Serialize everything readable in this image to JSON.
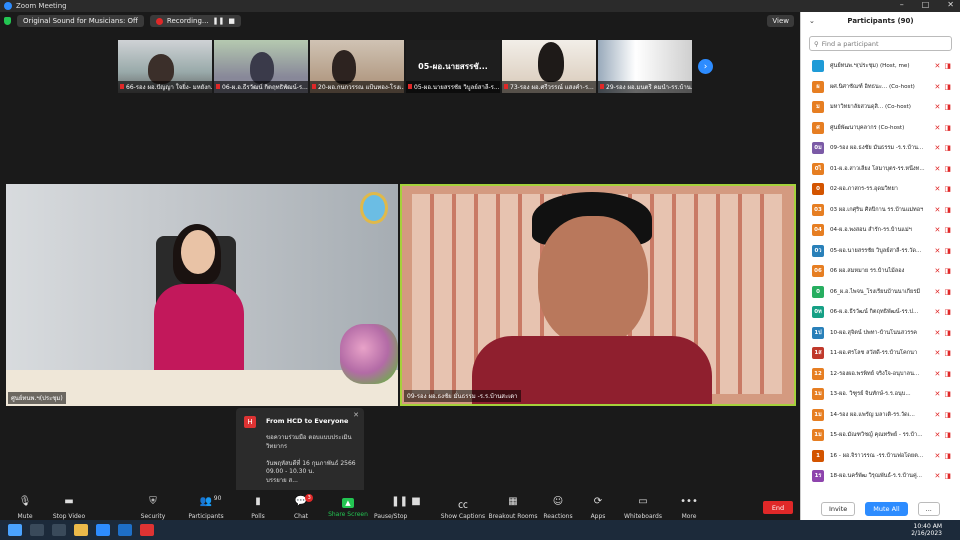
{
  "window": {
    "title": "Zoom Meeting"
  },
  "topbar": {
    "sound": "Original Sound for Musicians: Off",
    "recording": "Recording...",
    "view": "View"
  },
  "strip": [
    "66-รอง ผอ.ปัญญา ใจยิ่ง- มหยังก...",
    "06-ผ.อ.ธีรวัฒน์ กิตฤทธิพัฒน์-ร...",
    "20-ผอ.กนกวรรณ แป้นทอง-โรงเ...",
    "05-ผอ.นายสรรชัย วิบูลย์สาลี-ร...",
    "73-รอง ผอ.ศรีวรรณ์ แสงคำ-ร...",
    "29-รอง ผอ.มนตรี คมนำ-รร.บ้าน..."
  ],
  "strip_big_name": "05-ผอ.นายสรรชั...",
  "main": {
    "left_label": "ศูนย์ทนพ.ฯ(ประชุม)",
    "right_label": "09-รอง ผอ.ธงชัย มั่นธรรม -ร.ร.บ้านสะเดา"
  },
  "chat": {
    "avatar": "H",
    "header": "From HCD to Everyone",
    "body": "ขอความร่วมมือ ตอบแบบประเมิน\nวิทยากร\n\nวันพฤหัสบดีที่ 16 กุมภาพันธ์ 2566\n09.00 - 10.30 น.\nบรรยาย ส..."
  },
  "toolbar": {
    "mute": "Mute",
    "stop_video": "Stop Video",
    "security": "Security",
    "participants": "Participants",
    "participants_count": "90",
    "polls": "Polls",
    "chat": "Chat",
    "chat_badge": "3",
    "share": "Share Screen",
    "pause": "Pause/Stop Recording",
    "captions": "Show Captions",
    "breakout": "Breakout Rooms",
    "reactions": "Reactions",
    "apps": "Apps",
    "whiteboards": "Whiteboards",
    "more": "More",
    "end": "End"
  },
  "panel": {
    "title": "Participants (90)",
    "search_placeholder": "Find a participant",
    "invite": "Invite",
    "mute_all": "Mute All",
    "more": "..."
  },
  "participants": [
    {
      "av": "",
      "name": "ศูนย์ทนพ.ฯ(ประชุม)",
      "role": "(Host, me)",
      "color": "#1f9bd7"
    },
    {
      "av": "ผ",
      "name": "ผศ.นิศาชัณฑ์ อิทธนะ...",
      "role": "(Co-host)",
      "color": "#e67e22"
    },
    {
      "av": "ม",
      "name": "มหาวิทยาลัยสวนดุสิ...",
      "role": "(Co-host)",
      "color": "#e67e22"
    },
    {
      "av": "ศ",
      "name": "ศูนย์พัฒนาบุคลากร",
      "role": "(Co-host)",
      "color": "#e67e22"
    },
    {
      "av": "0ม",
      "name": "09-รอง ผอ.ธงชัย มั่นธรรม -ร.ร.บ้าน...",
      "role": "",
      "color": "#7b5aa6"
    },
    {
      "av": "0ไ",
      "name": "01-ผ.อ.สาวเลียง โสมาบุตร-รร.หนึ่งท...",
      "role": "",
      "color": "#e67e22"
    },
    {
      "av": "0",
      "name": "02-ผอ.ภาสกร-รร.อุดมวิทยา",
      "role": "",
      "color": "#d35400"
    },
    {
      "av": "03",
      "name": "03 ผอ.เกศุริน ศิลปิกาน รร.บ้านแม่ทอฯ",
      "role": "",
      "color": "#e67e22"
    },
    {
      "av": "04",
      "name": "04-ผ.อ.พงสอน สำรัก-รร.บ้านแม่ฯ",
      "role": "",
      "color": "#e67e22"
    },
    {
      "av": "0ว",
      "name": "05-ผอ.นายสรรชัย วิบูลย์สาลี-รร.วัด...",
      "role": "",
      "color": "#2980b9"
    },
    {
      "av": "06",
      "name": "06 ผอ.สมหมาย รร.บ้านไม้ลอง",
      "role": "",
      "color": "#e67e22"
    },
    {
      "av": "0",
      "name": "06_ผ.อ.ไพจน_โรงเรียนบ้านนาเกียรมี",
      "role": "",
      "color": "#27ae60"
    },
    {
      "av": "0ท",
      "name": "06-ผ.อ.ธีรวัฒน์ กิตฤทธิพัฒน์-รร.ป...",
      "role": "",
      "color": "#16a085"
    },
    {
      "av": "1ป",
      "name": "10-ผอ.สุจิตน์ ปพทา-บ้านโนนสวรรค",
      "role": "",
      "color": "#2980b9"
    },
    {
      "av": "1ส",
      "name": "11-ผอ.ศรโลช สวัสดี-รร.บ้านโคกนา",
      "role": "",
      "color": "#c0392b"
    },
    {
      "av": "12",
      "name": "12-รองผอ.พรพิทย์ จริงใจ-อนุบาลน...",
      "role": "",
      "color": "#e67e22"
    },
    {
      "av": "1ม",
      "name": "13-ผอ. วิฑูรย์ จินทักษ์-ร.ร.อนุบ...",
      "role": "",
      "color": "#e67e22"
    },
    {
      "av": "1ม",
      "name": "14-รอง ผอ.แพรัญ มลาเติ-รร.วัดเ...",
      "role": "",
      "color": "#e67e22"
    },
    {
      "av": "1ม",
      "name": "15-ผอ.มัณฑวิชญ์ คุณทรัพย์ - รร.บ้า...",
      "role": "",
      "color": "#e67e22"
    },
    {
      "av": "1",
      "name": "16 - ผอ.จิราวรรณ -รร.บ้านฟอโดยต...",
      "role": "",
      "color": "#d35400"
    },
    {
      "av": "1ร",
      "name": "18-ผอ.นคร์พัฒ วิรุณพันธ์-ร.ร.บ้านคู่...",
      "role": "",
      "color": "#8e44ad"
    }
  ],
  "taskbar": {
    "time": "10:40 AM",
    "date": "2/16/2023"
  }
}
